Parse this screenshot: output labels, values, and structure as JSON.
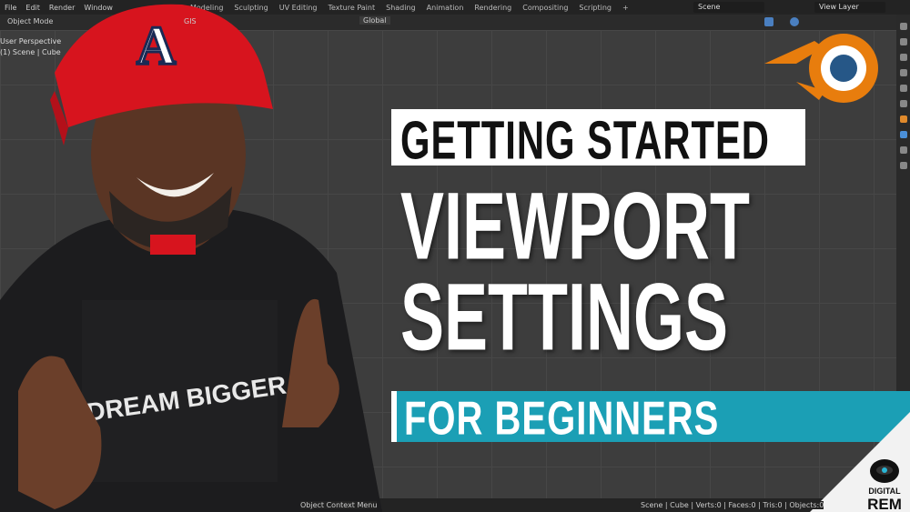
{
  "menu": [
    "File",
    "Edit",
    "Render",
    "Window"
  ],
  "workspace_tabs": [
    "GIS",
    "Modeling",
    "Sculpting",
    "UV Editing",
    "Texture Paint",
    "Shading",
    "Animation",
    "Rendering",
    "Compositing",
    "Scripting",
    "+"
  ],
  "scene_field": "Scene",
  "view_layer_field": "View Layer",
  "header": {
    "mode": "Object Mode",
    "gis": "GIS",
    "transform_orientation": "Global"
  },
  "viewport": {
    "perspective": "User Perspective",
    "collection": "(1) Scene | Cube"
  },
  "status": {
    "left": "Object Context Menu",
    "right": "Scene | Cube | Verts:0 | Faces:0 | Tris:0 | Objects:0"
  },
  "thumbnail": {
    "line1": "GETTING STARTED",
    "line2": "VIEWPORT",
    "line3": "SETTINGS",
    "line4": "FOR BEGINNERS",
    "shirt": "DREAM BIGGER",
    "logo": "DIGITAL REM"
  },
  "colors": {
    "teal": "#1b9fb5",
    "blender_orange": "#e87d0d",
    "blender_blue": "#265787",
    "cap_red": "#d7141e"
  }
}
